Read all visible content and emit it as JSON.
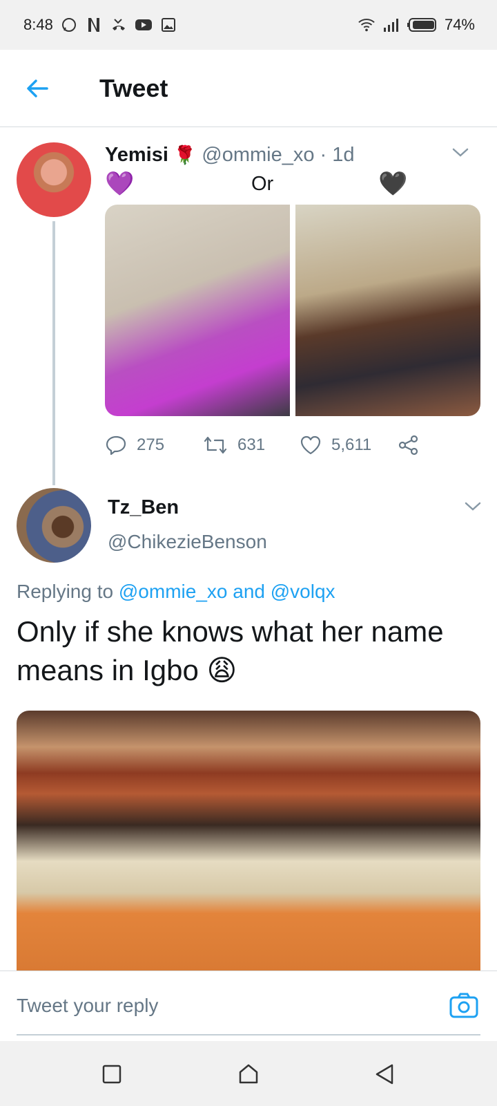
{
  "status_bar": {
    "time": "8:48",
    "battery": "74%",
    "icons": [
      "whatsapp-icon",
      "netflix-icon",
      "missed-call-icon",
      "youtube-icon",
      "gallery-icon",
      "wifi-icon",
      "signal-icon",
      "battery-icon"
    ]
  },
  "header": {
    "title": "Tweet",
    "back_icon": "arrow-left-icon"
  },
  "tweet1": {
    "name": "Yemisi",
    "name_emoji": "🌹",
    "handle": "@ommie_xo",
    "time": "· 1d",
    "emoji_left": "💜",
    "text": "Or",
    "emoji_right": "🖤",
    "counts": {
      "replies": "275",
      "retweets": "631",
      "likes": "5,611"
    }
  },
  "tweet2": {
    "name": "Tz_Ben",
    "handle": "@ChikezieBenson",
    "replying_prefix": "Replying to",
    "replying_user1": "@ommie_xo",
    "replying_and": "and",
    "replying_user2": "@volqx",
    "text": "Only if she knows what her name means in Igbo",
    "text_emoji": "😩"
  },
  "reply_bar": {
    "placeholder": "Tweet your reply"
  },
  "colors": {
    "accent": "#1da1f2",
    "secondary_text": "#657786",
    "thread_line": "#c4cfd6"
  }
}
